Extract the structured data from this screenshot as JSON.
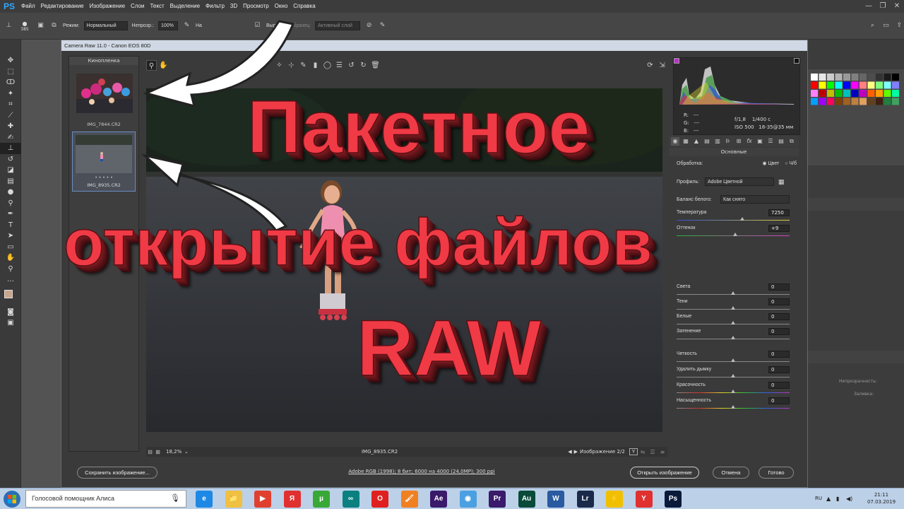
{
  "app": {
    "logo": "PS",
    "menu": [
      "Файл",
      "Редактирование",
      "Изображение",
      "Слои",
      "Текст",
      "Выделение",
      "Фильтр",
      "3D",
      "Просмотр",
      "Окно",
      "Справка"
    ]
  },
  "options": {
    "brush_size": "385",
    "mode_label": "Режим:",
    "mode_value": "Нормальный",
    "opacity_label": "Непрозр.:",
    "opacity_value": "100%",
    "press_label": "На",
    "align_label": "Выравн.",
    "sample_label": "Образец:",
    "sample_value": "Активный слой"
  },
  "dialog": {
    "title": "Camera Raw 11.0  -  Canon EOS 80D",
    "filmstrip_title": "Кинопленка",
    "thumbs": [
      {
        "caption": "IMG_7844.CR2"
      },
      {
        "caption": "IMG_8935.CR2",
        "stars": "• • • • •"
      }
    ],
    "zoom": "18,2%",
    "filename": "IMG_8935.CR2",
    "image_counter": "Изображение 2/2",
    "save_button": "Сохранить изображение...",
    "workflow_link": "Adobe RGB (1998); 8 бит; 6000 на 4000 (24,0MP); 300 ppi",
    "open_button": "Открыть изображение",
    "cancel_button": "Отмена",
    "done_button": "Готово"
  },
  "histogram": {
    "r_label": "R:",
    "g_label": "G:",
    "b_label": "B:",
    "r_val": "---",
    "g_val": "---",
    "b_val": "---",
    "aperture": "f/1,8",
    "shutter": "1/400 с",
    "iso": "ISO 500",
    "lens": "18-35@35 мм"
  },
  "basic": {
    "panel_title": "Основные",
    "processing_label": "Обработка:",
    "color_option": "Цвет",
    "bw_option": "Ч/б",
    "profile_label": "Профиль:",
    "profile_value": "Adobe Цветной",
    "wb_label": "Баланс белого:",
    "wb_value": "Как снято",
    "sliders": [
      {
        "label": "Температура",
        "value": "7250",
        "pos": 0.58
      },
      {
        "label": "Оттенок",
        "value": "+9",
        "pos": 0.52
      },
      {
        "label": "Света",
        "value": "0",
        "pos": 0.5
      },
      {
        "label": "Тени",
        "value": "0",
        "pos": 0.5
      },
      {
        "label": "Белые",
        "value": "0",
        "pos": 0.5
      },
      {
        "label": "Затенение",
        "value": "0",
        "pos": 0.5
      },
      {
        "label": "Четкость",
        "value": "0",
        "pos": 0.5
      },
      {
        "label": "Удалить дымку",
        "value": "0",
        "pos": 0.5
      },
      {
        "label": "Красочность",
        "value": "0",
        "pos": 0.5
      },
      {
        "label": "Насыщенность",
        "value": "0",
        "pos": 0.5
      }
    ]
  },
  "overlay": {
    "line1": "Пакетное",
    "line2": "открытие файлов",
    "line3": "RAW"
  },
  "right_panel": {
    "opacity_label": "Непрозрачность:",
    "fill_label": "Заливка:"
  },
  "taskbar": {
    "search_text": "Голосовой помощник Алиса",
    "lang": "RU",
    "time": "21:11",
    "date": "07.03.2019",
    "apps": [
      "e",
      "📁",
      "▶",
      "Я",
      "µ",
      "∞",
      "O",
      "🖌",
      "Ae",
      "◉",
      "Pr",
      "Au",
      "W",
      "Lr",
      "⚡",
      "Y",
      "Ps"
    ]
  },
  "colors": {
    "overlay_red": "#f03a45",
    "ps_blue": "#31a8ff"
  }
}
